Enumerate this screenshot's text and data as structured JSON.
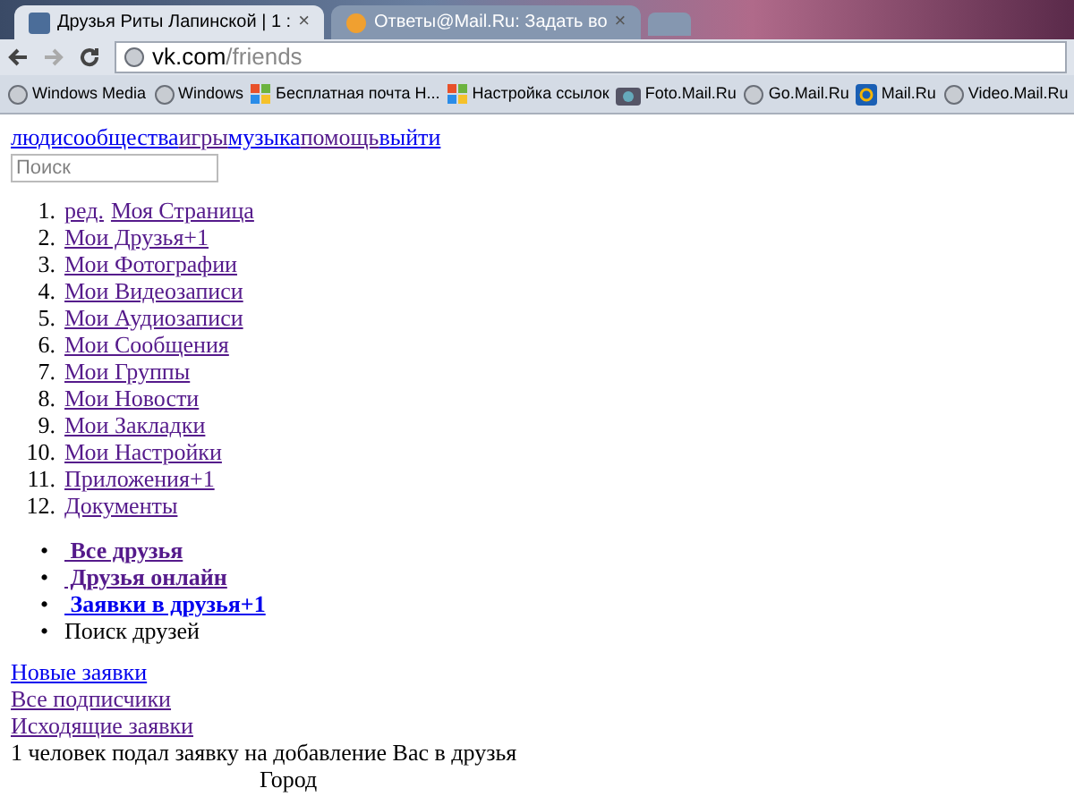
{
  "tabs": [
    {
      "title": "Друзья Риты Лапинской | 1 :",
      "selected": true,
      "close": "×"
    },
    {
      "title": "Ответы@Mail.Ru: Задать во",
      "selected": false,
      "close": "×"
    }
  ],
  "address": {
    "host": "vk.com",
    "path": "/friends"
  },
  "bookmarks": [
    "Windows Media",
    "Windows",
    "Бесплатная почта Н...",
    "Настройка ссылок",
    "Foto.Mail.Ru",
    "Go.Mail.Ru",
    "Mail.Ru",
    "Video.Mail.Ru"
  ],
  "top_nav": [
    {
      "label": "люди",
      "visited": false
    },
    {
      "label": "сообщества",
      "visited": false
    },
    {
      "label": "игры",
      "visited": true
    },
    {
      "label": "музыка",
      "visited": false
    },
    {
      "label": "помощь",
      "visited": true
    },
    {
      "label": "выйти",
      "visited": false
    }
  ],
  "search": {
    "placeholder": "Поиск"
  },
  "menu": [
    {
      "number": "1.",
      "links": [
        {
          "label": "ред.",
          "visited": true
        },
        {
          "label": "Моя Страница",
          "visited": true
        }
      ]
    },
    {
      "number": "2.",
      "links": [
        {
          "label": "Мои Друзья+1",
          "visited": true
        }
      ]
    },
    {
      "number": "3.",
      "links": [
        {
          "label": "Мои Фотографии",
          "visited": true
        }
      ]
    },
    {
      "number": "4.",
      "links": [
        {
          "label": "Мои Видеозаписи",
          "visited": true
        }
      ]
    },
    {
      "number": "5.",
      "links": [
        {
          "label": "Мои Аудиозаписи",
          "visited": true
        }
      ]
    },
    {
      "number": "6.",
      "links": [
        {
          "label": "Мои Сообщения",
          "visited": true
        }
      ]
    },
    {
      "number": "7.",
      "links": [
        {
          "label": "Мои Группы",
          "visited": true
        }
      ]
    },
    {
      "number": "8.",
      "links": [
        {
          "label": "Мои Новости",
          "visited": true
        }
      ]
    },
    {
      "number": "9.",
      "links": [
        {
          "label": "Мои Закладки",
          "visited": true
        }
      ]
    },
    {
      "number": "10.",
      "links": [
        {
          "label": "Мои Настройки",
          "visited": true
        }
      ]
    },
    {
      "number": "11.",
      "links": [
        {
          "label": "Приложения+1",
          "visited": true
        }
      ]
    },
    {
      "number": "12.",
      "links": [
        {
          "label": "Документы",
          "visited": true
        }
      ]
    }
  ],
  "friend_tabs": [
    {
      "bullet": "•",
      "label": " Все друзья",
      "kind": "link",
      "visited": true
    },
    {
      "bullet": "•",
      "label": " Друзья онлайн",
      "kind": "link",
      "visited": true
    },
    {
      "bullet": "•",
      "label": " Заявки в друзья+1",
      "kind": "link",
      "visited": false
    },
    {
      "bullet": "•",
      "label": "Поиск друзей",
      "kind": "text",
      "visited": false
    }
  ],
  "request_links": [
    {
      "label": "Новые заявки",
      "visited": false
    },
    {
      "label": "Все подписчики",
      "visited": true
    },
    {
      "label": "Исходящие заявки",
      "visited": true
    }
  ],
  "notice": "1 человек подал заявку на добавление Вас в друзья",
  "column_heading": "Город"
}
